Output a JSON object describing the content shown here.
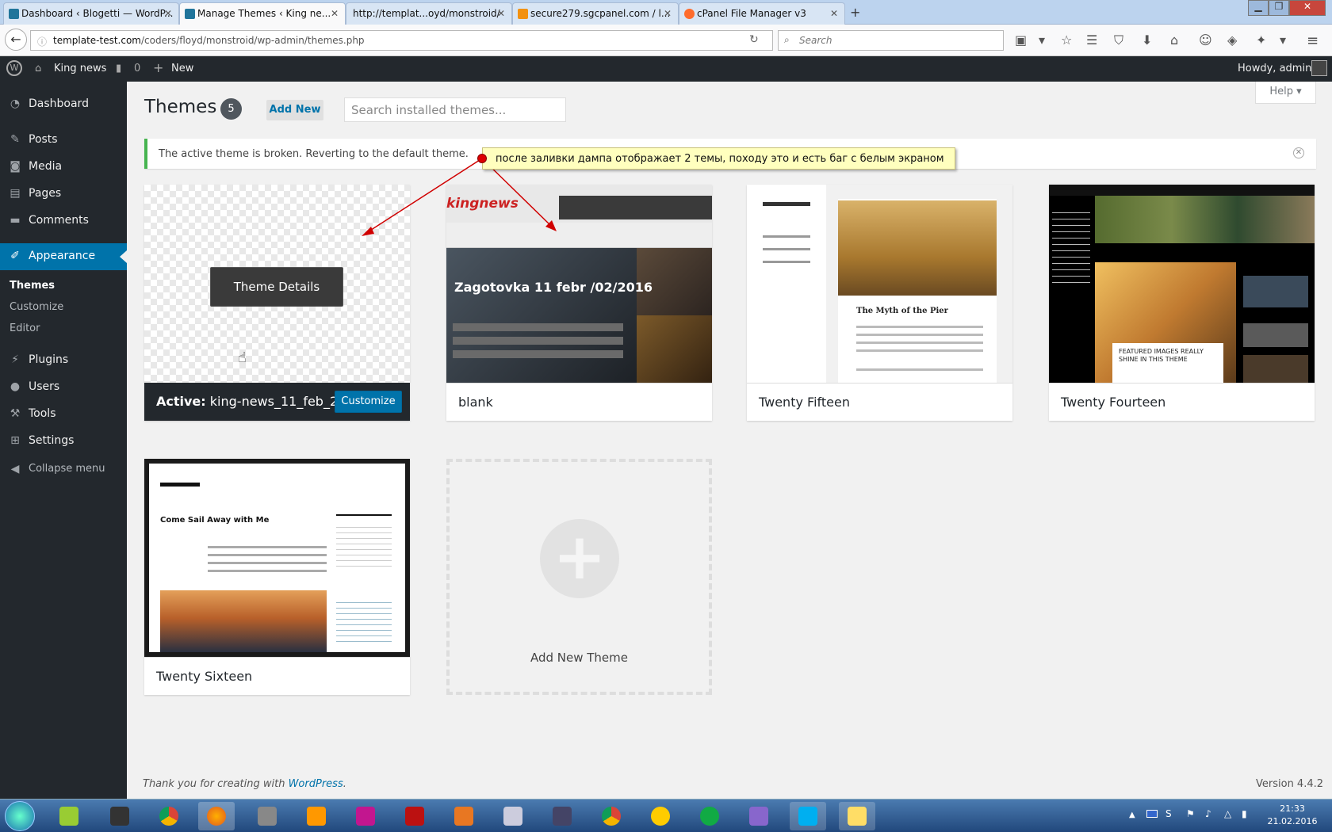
{
  "browser": {
    "tabs": [
      {
        "label": "Dashboard ‹ Blogetti — WordP...",
        "icon_color": "#21759b"
      },
      {
        "label": "Manage Themes ‹ King ne...",
        "icon_color": "#21759b"
      },
      {
        "label": "http://templat...oyd/monstroid/",
        "icon_color": ""
      },
      {
        "label": "secure279.sgcpanel.com / l...",
        "icon_color": "#f29111"
      },
      {
        "label": "cPanel File Manager v3",
        "icon_color": "#ff6c2c"
      }
    ],
    "url_host": "template-test.com",
    "url_path": "/coders/floyd/monstroid/wp-admin/themes.php",
    "search_placeholder": "Search"
  },
  "adminbar": {
    "site_name": "King news",
    "comments_count": "0",
    "new_label": "New",
    "howdy": "Howdy, admin"
  },
  "sidebar": {
    "items": [
      {
        "label": "Dashboard",
        "icon": "dashboard-icon"
      },
      {
        "label": "Posts",
        "icon": "pin-icon"
      },
      {
        "label": "Media",
        "icon": "media-icon"
      },
      {
        "label": "Pages",
        "icon": "pages-icon"
      },
      {
        "label": "Comments",
        "icon": "comment-icon"
      },
      {
        "label": "Appearance",
        "icon": "brush-icon"
      },
      {
        "label": "Plugins",
        "icon": "plug-icon"
      },
      {
        "label": "Users",
        "icon": "user-icon"
      },
      {
        "label": "Tools",
        "icon": "wrench-icon"
      },
      {
        "label": "Settings",
        "icon": "settings-icon"
      }
    ],
    "submenu": [
      "Themes",
      "Customize",
      "Editor"
    ],
    "collapse": "Collapse menu"
  },
  "page": {
    "title": "Themes",
    "count": "5",
    "add_new": "Add New",
    "search_placeholder": "Search installed themes...",
    "help": "Help",
    "notice": "The active theme is broken. Reverting to the default theme.",
    "annotation": "после заливки дампа отображает 2 темы, походу это и есть баг с белым экраном"
  },
  "themes": {
    "active_prefix": "Active:",
    "active_name": "king-news_11_feb_20...",
    "customize": "Customize",
    "theme_details": "Theme Details",
    "blank": "blank",
    "blank_headline": "Zagotovka 11 febr /02/2016",
    "blank_logo": "kingnews",
    "twenty_fifteen": "Twenty Fifteen",
    "twenty_fifteen_post": "The Myth of the Pier",
    "twenty_fourteen": "Twenty Fourteen",
    "twenty_fourteen_feature": "FEATURED IMAGES REALLY SHINE IN THIS THEME",
    "twenty_sixteen": "Twenty Sixteen",
    "twenty_sixteen_post": "Come Sail Away with Me",
    "add_new_theme": "Add New Theme"
  },
  "footer": {
    "thanks": "Thank you for creating with ",
    "wp_link": "WordPress",
    "version": "Version 4.4.2"
  },
  "taskbar": {
    "time": "21:33",
    "date": "21.02.2016"
  },
  "colors": {
    "accent": "#0073aa",
    "admin_dark": "#23282d",
    "notice_green": "#46b450",
    "annotation_bg": "#ffffbe",
    "arrow_red": "#d00000"
  }
}
